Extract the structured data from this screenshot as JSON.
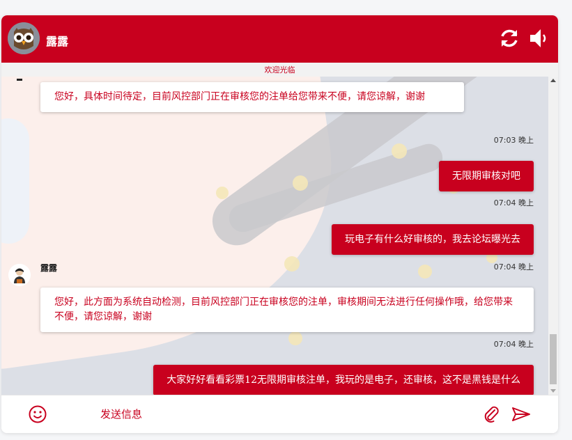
{
  "header": {
    "agent_name": "露露",
    "refresh_icon": "refresh-icon",
    "sound_icon": "speaker-icon"
  },
  "welcome_text": "欢迎光临",
  "messages": [
    {
      "type": "in",
      "text": "您好，具体时间待定，目前风控部门正在审核您的注单给您带来不便，请您谅解，谢谢"
    },
    {
      "type": "out",
      "time": "07:03 晚上",
      "text": "无限期审核对吧"
    },
    {
      "type": "out",
      "time": "07:04 晚上",
      "text": "玩电子有什么好审核的，我去论坛曝光去"
    },
    {
      "type": "in",
      "sender": "露露",
      "time": "07:04 晚上",
      "text": "您好，此方面为系统自动检测，目前风控部门正在审核您的注单，审核期间无法进行任何操作哦，给您带来不便，请您谅解，谢谢"
    },
    {
      "type": "out",
      "time": "07:04 晚上",
      "text": "大家好好看看彩票12无限期审核注单，我玩的是电子，还审核，这不是黑钱是什么"
    }
  ],
  "footer": {
    "input_placeholder": "发送信息",
    "emoji_icon": "emoji-icon",
    "attach_icon": "paperclip-icon",
    "send_icon": "send-icon"
  },
  "colors": {
    "brand": "#c8001e",
    "bubble_in_bg": "#ffffff",
    "bubble_out_bg": "#c8001e"
  }
}
